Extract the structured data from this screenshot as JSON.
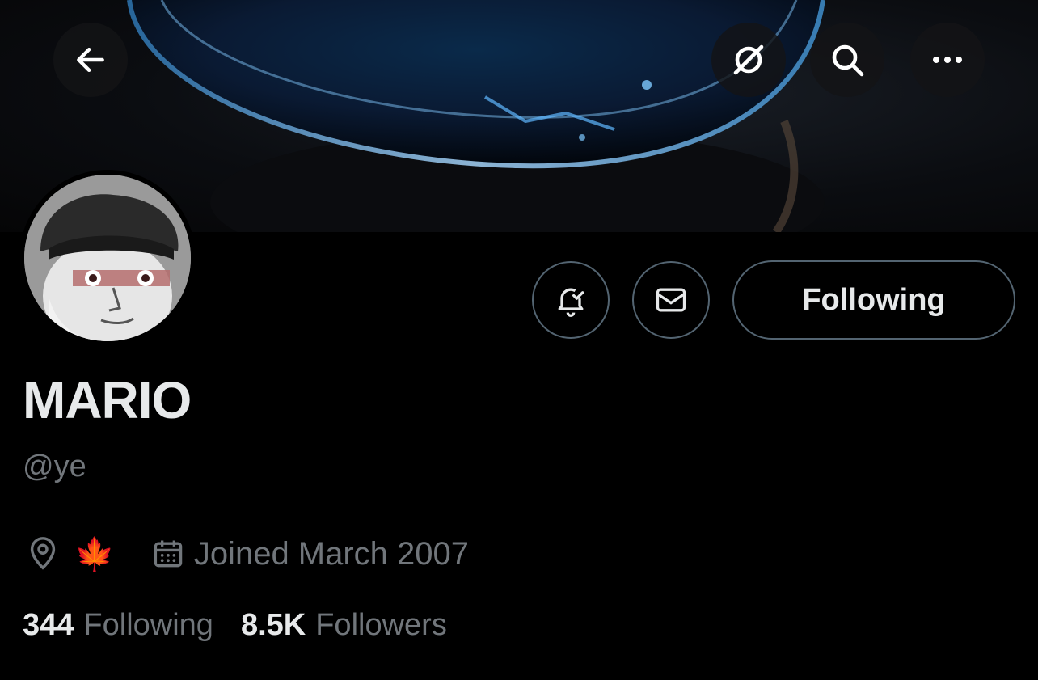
{
  "profile": {
    "display_name": "MARIO",
    "handle": "@ye",
    "location_flag": "🍁",
    "joined": "Joined March 2007"
  },
  "actions": {
    "follow_label": "Following"
  },
  "stats": {
    "following_count": "344",
    "following_label": "Following",
    "followers_count": "8.5K",
    "followers_label": "Followers"
  },
  "icons": {
    "back": "back-arrow-icon",
    "grok": "grok-icon",
    "search": "search-icon",
    "more": "more-icon",
    "notify": "notification-bell-icon",
    "message": "mail-icon",
    "location": "location-pin-icon",
    "calendar": "calendar-icon"
  },
  "colors": {
    "background": "#000000",
    "text_primary": "#e7e9ea",
    "text_secondary": "#71767b",
    "border": "#536471"
  }
}
